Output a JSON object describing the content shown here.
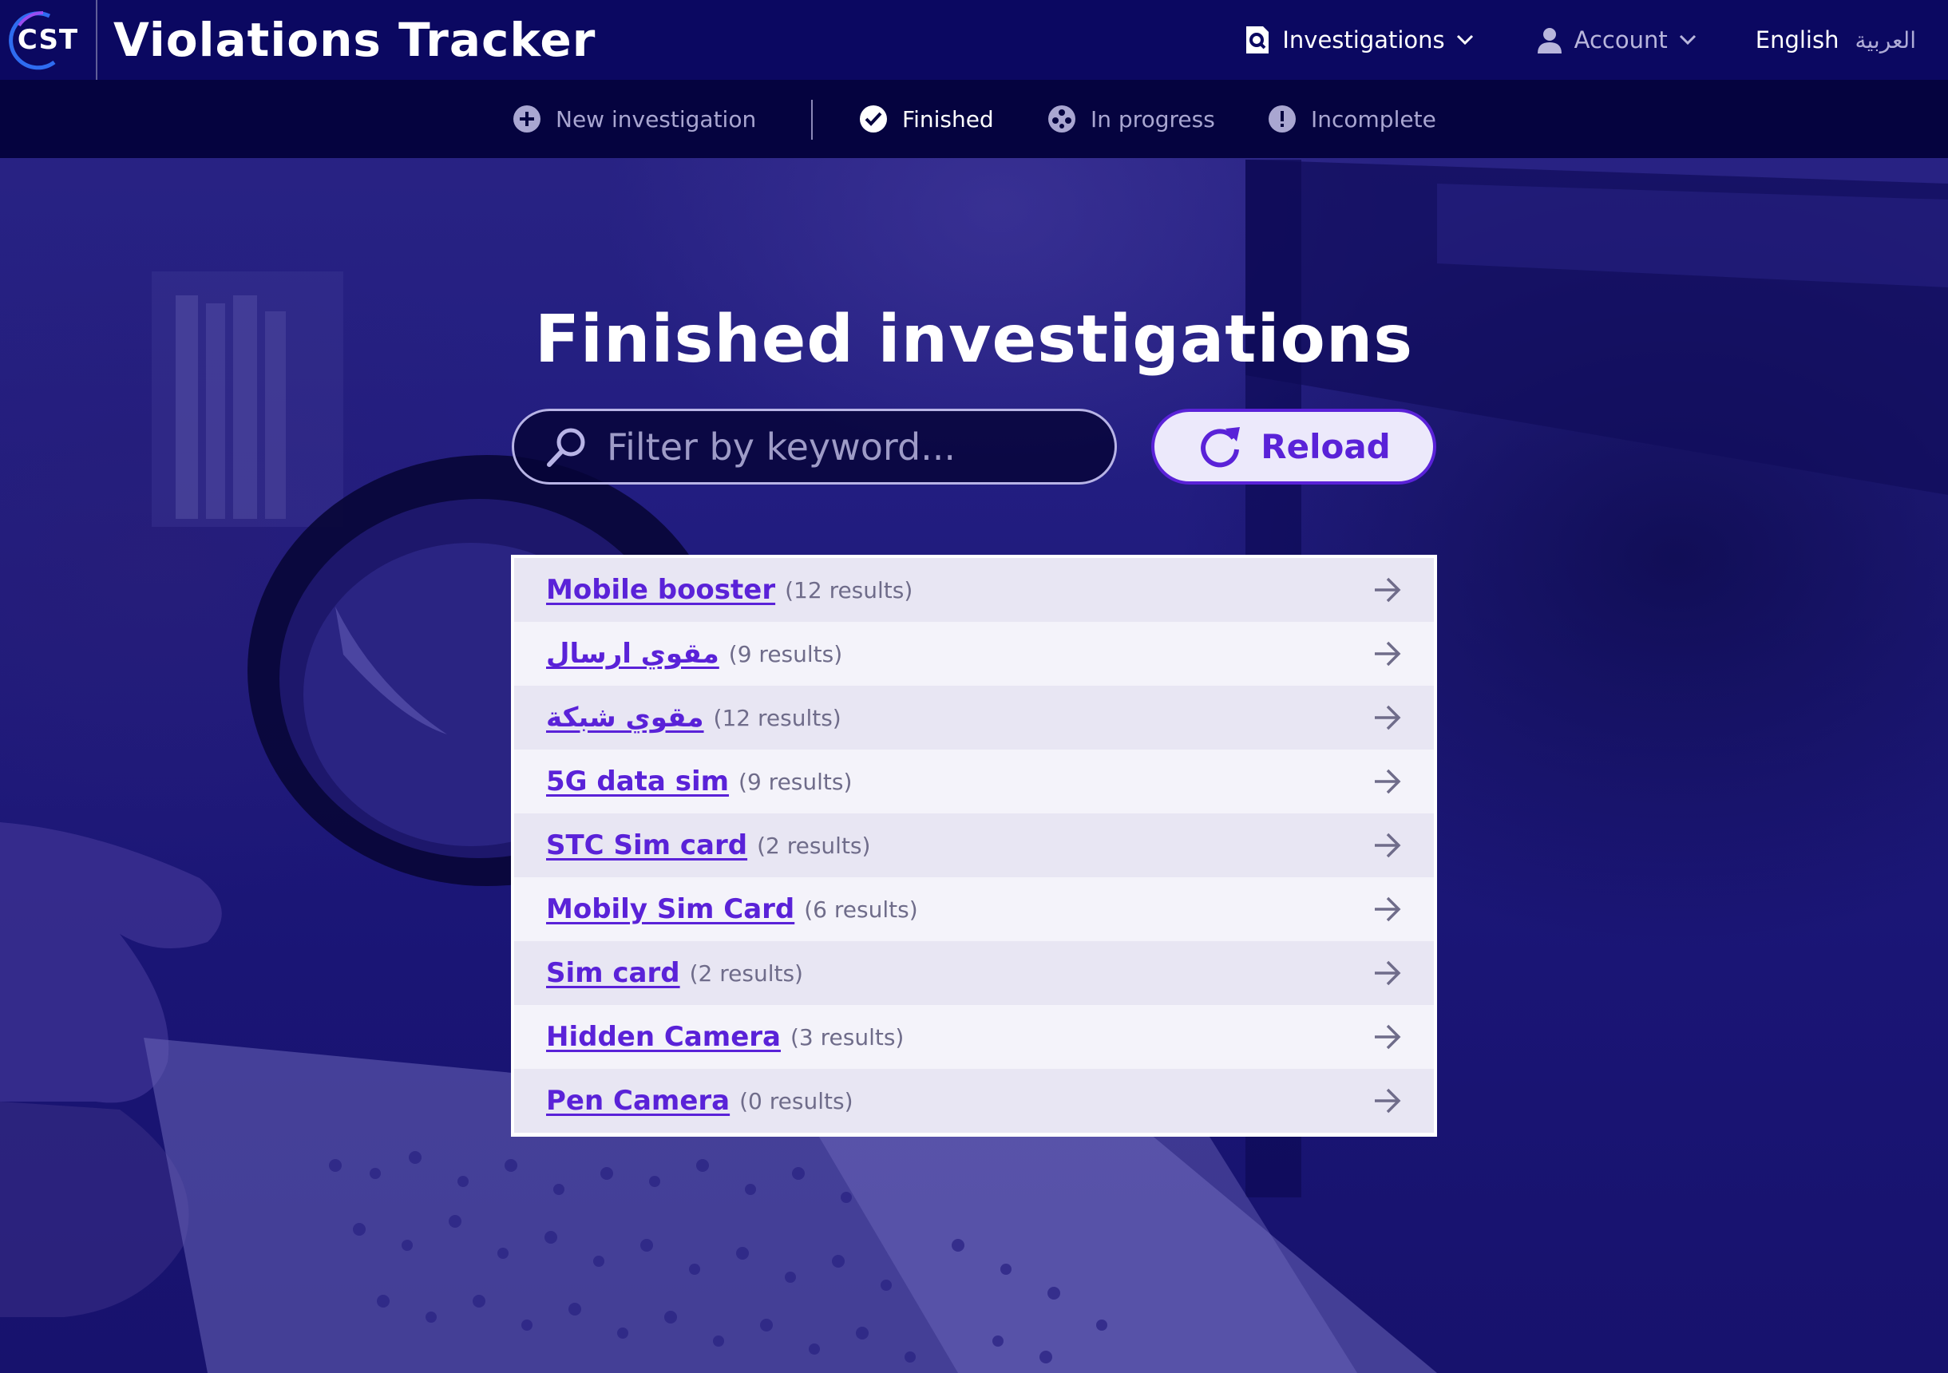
{
  "header": {
    "logo": "CST",
    "title": "Violations Tracker",
    "nav": {
      "investigations": "Investigations",
      "account": "Account",
      "lang_en": "English",
      "lang_ar": "العربية"
    }
  },
  "subnav": {
    "new": "New investigation",
    "finished": "Finished",
    "in_progress": "In progress",
    "incomplete": "Incomplete"
  },
  "main": {
    "title": "Finished investigations",
    "search_placeholder": "Filter by keyword...",
    "reload_label": "Reload"
  },
  "results": [
    {
      "name": "Mobile booster",
      "count": "(12 results)"
    },
    {
      "name": "مقوي ارسال",
      "count": "(9 results)"
    },
    {
      "name": "مقوي شبكة",
      "count": "(12 results)"
    },
    {
      "name": "5G data sim",
      "count": "(9 results)"
    },
    {
      "name": "STC Sim card",
      "count": "(2 results)"
    },
    {
      "name": "Mobily Sim Card",
      "count": "(6 results)"
    },
    {
      "name": "Sim card",
      "count": "(2 results)"
    },
    {
      "name": "Hidden Camera",
      "count": "(3 results)"
    },
    {
      "name": "Pen Camera",
      "count": "(0 results)"
    }
  ],
  "colors": {
    "header_bg": "#0b0861",
    "subnav_bg": "#05033f",
    "accent": "#5a22d8",
    "background": "#1a1575"
  }
}
